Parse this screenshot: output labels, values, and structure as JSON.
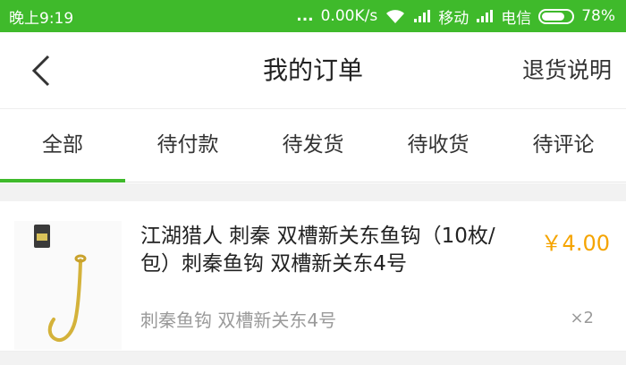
{
  "status_bar": {
    "time": "晚上9:19",
    "dots": "...",
    "speed": "0.00K/s",
    "carrier1": "移动",
    "carrier2": "电信",
    "battery": "78%",
    "battery_level": 0.78,
    "icons": [
      "wifi-icon",
      "signal-icon",
      "signal-icon",
      "battery-icon"
    ]
  },
  "nav": {
    "back_icon": "chevron-left-icon",
    "title": "我的订单",
    "action": "退货说明"
  },
  "tabs": [
    {
      "label": "全部",
      "active": true
    },
    {
      "label": "待付款",
      "active": false
    },
    {
      "label": "待发货",
      "active": false
    },
    {
      "label": "待收货",
      "active": false
    },
    {
      "label": "待评论",
      "active": false
    }
  ],
  "order": {
    "title": "江湖猎人 刺秦 双槽新关东鱼钩（10枚/包）刺秦鱼钩 双槽新关东4号",
    "price": "￥4.00",
    "variant": "刺秦鱼钩 双槽新关东4号",
    "quantity": "×2",
    "image_icon": "fish-hook-icon"
  },
  "colors": {
    "accent": "#3fba2b",
    "price": "#f5a400"
  }
}
